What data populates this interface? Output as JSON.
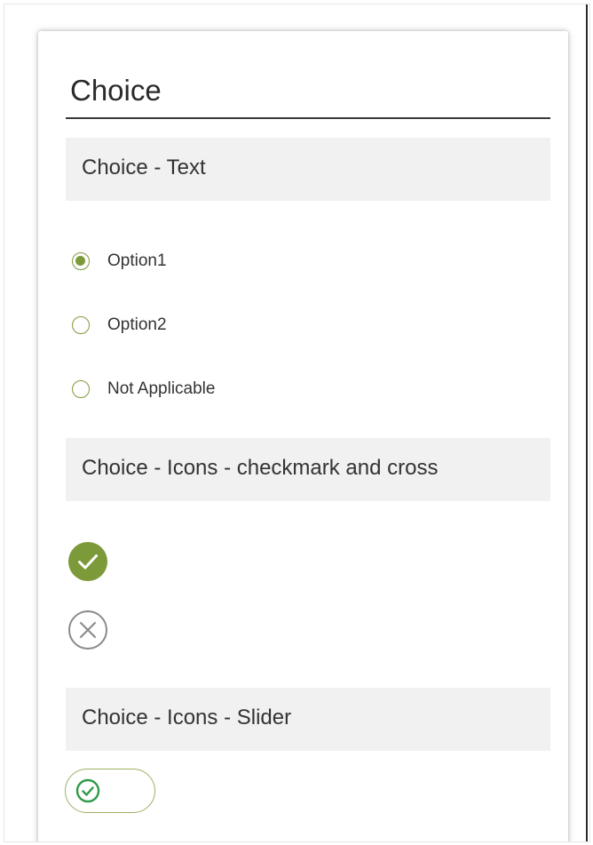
{
  "form": {
    "title": "Choice"
  },
  "sections": {
    "text": {
      "label": "Choice - Text",
      "options": [
        {
          "label": "Option1",
          "selected": true
        },
        {
          "label": "Option2",
          "selected": false
        },
        {
          "label": "Not Applicable",
          "selected": false
        }
      ]
    },
    "icons": {
      "label": "Choice - Icons - checkmark and cross",
      "checkmark_icon": "check-circle-filled-icon",
      "cross_icon": "cross-circle-outline-icon"
    },
    "slider": {
      "label": "Choice - Icons - Slider",
      "state_icon": "check-circle-outline-icon"
    }
  },
  "colors": {
    "accent": "#7d9a3a",
    "toggle_check": "#2f9a4a",
    "section_bg": "#f1f1f1",
    "cross_gray": "#8a8a8a"
  }
}
